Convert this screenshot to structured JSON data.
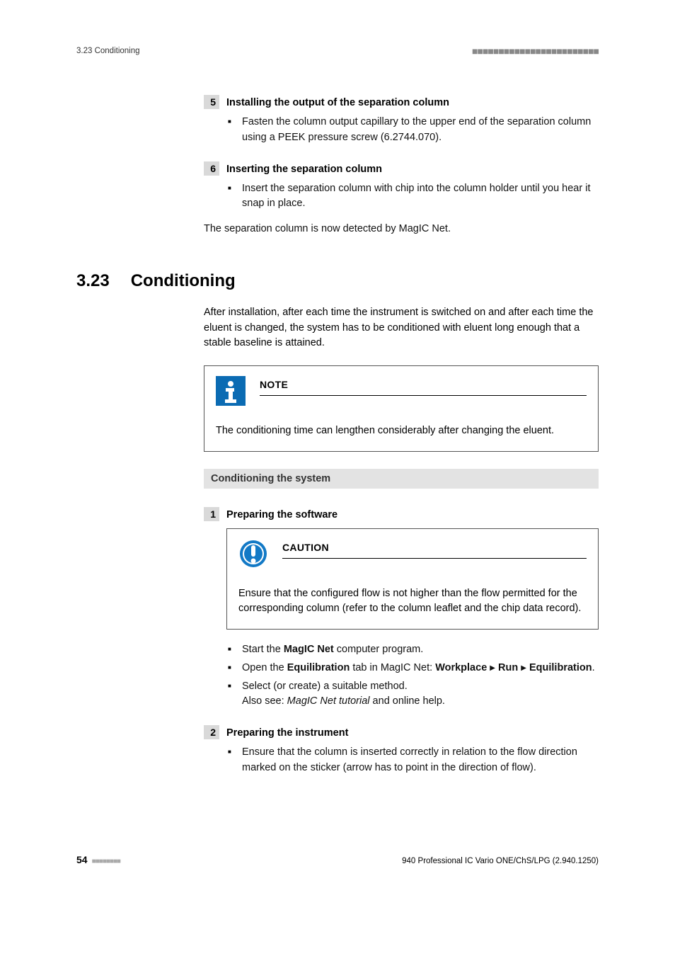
{
  "header": {
    "left": "3.23 Conditioning"
  },
  "step5": {
    "num": "5",
    "title": "Installing the output of the separation column",
    "bullet1": "Fasten the column output capillary to the upper end of the separation column using a PEEK pressure screw (6.2744.070)."
  },
  "step6": {
    "num": "6",
    "title": "Inserting the separation column",
    "bullet1": "Insert the separation column with chip into the column holder until you hear it snap in place.",
    "after": "The separation column is now detected by MagIC Net."
  },
  "section": {
    "num": "3.23",
    "title": "Conditioning"
  },
  "intro": "After installation, after each time the instrument is switched on and after each time the eluent is changed, the system has to be conditioned with eluent long enough that a stable baseline is attained.",
  "note": {
    "label": "NOTE",
    "body": "The conditioning time can lengthen considerably after changing the eluent."
  },
  "subsection": "Conditioning the system",
  "step1": {
    "num": "1",
    "title": "Preparing the software",
    "caution_label": "CAUTION",
    "caution_body": "Ensure that the configured flow is not higher than the flow permitted for the corresponding column (refer to the column leaflet and the chip data record).",
    "b1a": "Start the ",
    "b1b": "MagIC Net",
    "b1c": " computer program.",
    "b2a": "Open the ",
    "b2b": "Equilibration",
    "b2c": " tab in MagIC Net: ",
    "b2d": "Workplace",
    "b2e": "Run",
    "b2f": "Equilibration",
    "b3a": "Select (or create) a suitable method.",
    "b3b_a": "Also see: ",
    "b3b_b": "MagIC Net tutorial",
    "b3b_c": " and online help."
  },
  "step2": {
    "num": "2",
    "title": "Preparing the instrument",
    "bullet1": "Ensure that the column is inserted correctly in relation to the flow direction marked on the sticker (arrow has to point in the direction of flow)."
  },
  "footer": {
    "page": "54",
    "right": "940 Professional IC Vario ONE/ChS/LPG (2.940.1250)"
  }
}
